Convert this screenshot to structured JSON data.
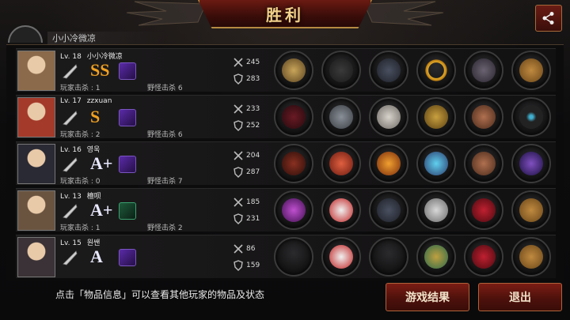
{
  "header": {
    "title": "胜利",
    "share_icon": "share-icon"
  },
  "top_player": {
    "name_partial": "小小冷微凉"
  },
  "labels": {
    "player_kills_prefix": "玩家击杀",
    "mob_kills_prefix": "野怪击杀"
  },
  "players": [
    {
      "level": "Lv. 18",
      "name": "小小冷微凉",
      "weapon": "fist-icon",
      "grade": "SS",
      "grade_color": "#f0a020",
      "skill_color": "purple",
      "player_kills": "玩家击杀 : 1",
      "mob_kills": "野怪击杀 6",
      "attack": "245",
      "defense": "283",
      "items": [
        "gauntlet",
        "bomb",
        "armor",
        "ring",
        "boots",
        "crate"
      ]
    },
    {
      "level": "Lv. 17",
      "name": "zzxuan",
      "weapon": "sickle-icon",
      "grade": "S",
      "grade_color": "#f0a020",
      "skill_color": "purple",
      "player_kills": "玩家击杀 : 2",
      "mob_kills": "野怪击杀 6",
      "attack": "233",
      "defense": "252",
      "items": [
        "crossbow",
        "helmet",
        "armor-white",
        "shield",
        "bracer",
        "necklace"
      ]
    },
    {
      "level": "Lv. 16",
      "name": "영욱",
      "weapon": "cleaver-icon",
      "grade": "A+",
      "grade_color": "#e8e8ff",
      "skill_color": "purple",
      "player_kills": "玩家击杀 : 0",
      "mob_kills": "野怪击杀 7",
      "attack": "204",
      "defense": "287",
      "items": [
        "spear",
        "helmet-red",
        "flame-armor",
        "gem-staff",
        "bracer",
        "galaxy"
      ]
    },
    {
      "level": "Lv. 13",
      "name": "檀呗",
      "weapon": "bat-icon",
      "grade": "A+",
      "grade_color": "#e8e8ff",
      "skill_color": "green",
      "player_kills": "玩家击杀 : 1",
      "mob_kills": "野怪击杀 2",
      "attack": "185",
      "defense": "231",
      "items": [
        "staff",
        "helmet-white",
        "armor",
        "disc",
        "heels",
        "crate"
      ]
    },
    {
      "level": "Lv. 15",
      "name": "원쌘",
      "weapon": "bat-icon",
      "grade": "A",
      "grade_color": "#e8e8ff",
      "skill_color": "purple",
      "player_kills": "",
      "mob_kills": "",
      "attack": "86",
      "defense": "159",
      "items": [
        "empty",
        "helmet-white",
        "empty",
        "bracelet",
        "heels",
        "crate"
      ]
    }
  ],
  "footer": {
    "hint": "点击「物品信息」可以查看其他玩家的物品及状态",
    "result_button": "游戏结果",
    "exit_button": "退出"
  }
}
